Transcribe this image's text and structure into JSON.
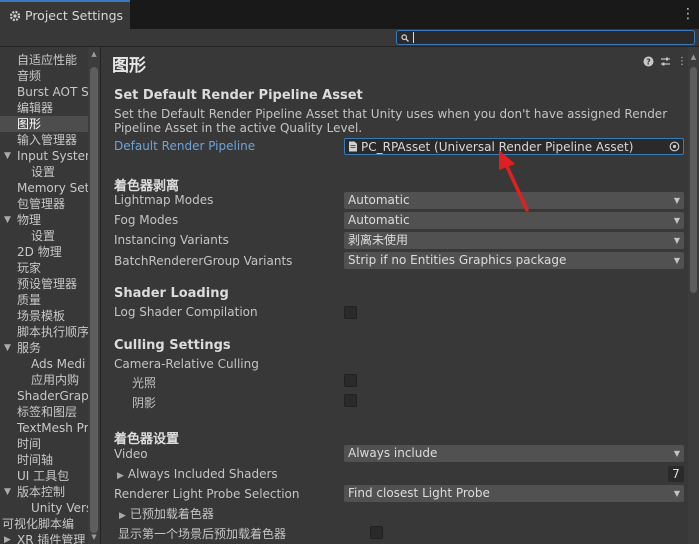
{
  "window": {
    "tab_title": "Project Settings",
    "tab_icon": "gear-icon",
    "menu_icon": "kebab-menu-icon"
  },
  "search": {
    "value": "",
    "icon": "search-icon"
  },
  "sidebar": {
    "items": [
      {
        "label": "自适应性能",
        "indent": 1,
        "expander": "",
        "selected": false
      },
      {
        "label": "音频",
        "indent": 1,
        "expander": "",
        "selected": false
      },
      {
        "label": "Burst AOT S",
        "indent": 1,
        "expander": "",
        "selected": false
      },
      {
        "label": "编辑器",
        "indent": 1,
        "expander": "",
        "selected": false
      },
      {
        "label": "图形",
        "indent": 1,
        "expander": "",
        "selected": true
      },
      {
        "label": "输入管理器",
        "indent": 1,
        "expander": "",
        "selected": false
      },
      {
        "label": "Input Systen",
        "indent": 1,
        "expander": "▼",
        "selected": false
      },
      {
        "label": "设置",
        "indent": 2,
        "expander": "",
        "selected": false
      },
      {
        "label": "Memory Set",
        "indent": 1,
        "expander": "",
        "selected": false
      },
      {
        "label": "包管理器",
        "indent": 1,
        "expander": "",
        "selected": false
      },
      {
        "label": "物理",
        "indent": 1,
        "expander": "▼",
        "selected": false
      },
      {
        "label": "设置",
        "indent": 2,
        "expander": "",
        "selected": false
      },
      {
        "label": "2D 物理",
        "indent": 1,
        "expander": "",
        "selected": false
      },
      {
        "label": "玩家",
        "indent": 1,
        "expander": "",
        "selected": false
      },
      {
        "label": "预设管理器",
        "indent": 1,
        "expander": "",
        "selected": false
      },
      {
        "label": "质量",
        "indent": 1,
        "expander": "",
        "selected": false
      },
      {
        "label": "场景模板",
        "indent": 1,
        "expander": "",
        "selected": false
      },
      {
        "label": "脚本执行顺序",
        "indent": 1,
        "expander": "",
        "selected": false
      },
      {
        "label": "服务",
        "indent": 1,
        "expander": "▼",
        "selected": false
      },
      {
        "label": "Ads Medi",
        "indent": 2,
        "expander": "",
        "selected": false
      },
      {
        "label": "应用内购",
        "indent": 2,
        "expander": "",
        "selected": false
      },
      {
        "label": "ShaderGrapl",
        "indent": 1,
        "expander": "",
        "selected": false
      },
      {
        "label": "标签和图层",
        "indent": 1,
        "expander": "",
        "selected": false
      },
      {
        "label": "TextMesh Pr",
        "indent": 1,
        "expander": "",
        "selected": false
      },
      {
        "label": "时间",
        "indent": 1,
        "expander": "",
        "selected": false
      },
      {
        "label": "时间轴",
        "indent": 1,
        "expander": "",
        "selected": false
      },
      {
        "label": "UI 工具包",
        "indent": 1,
        "expander": "",
        "selected": false
      },
      {
        "label": "版本控制",
        "indent": 1,
        "expander": "▼",
        "selected": false
      },
      {
        "label": "Unity Vers",
        "indent": 2,
        "expander": "",
        "selected": false
      },
      {
        "label": "可视化脚本编",
        "indent": 0,
        "expander": "",
        "selected": false
      },
      {
        "label": "XR 插件管理",
        "indent": 1,
        "expander": "▶",
        "selected": false
      }
    ]
  },
  "main": {
    "title": "图形",
    "header_icons": [
      "help-icon",
      "preset-icon",
      "kebab-menu-icon"
    ],
    "pipeline_section": {
      "heading": "Set Default Render Pipeline Asset",
      "description": "Set the Default Render Pipeline Asset that Unity uses when you don't have assigned Render Pipeline Asset in the active Quality Level.",
      "field_label": "Default Render Pipeline",
      "field_value": "PC_RPAsset (Universal Render Pipeline Asset)"
    },
    "stripping_section": {
      "heading": "着色器剥离",
      "rows": [
        {
          "label": "Lightmap Modes",
          "value": "Automatic"
        },
        {
          "label": "Fog Modes",
          "value": "Automatic"
        },
        {
          "label": "Instancing Variants",
          "value": "剥离未使用"
        },
        {
          "label": "BatchRendererGroup Variants",
          "value": "Strip if no Entities Graphics package"
        }
      ]
    },
    "loading_section": {
      "heading": "Shader Loading",
      "log_label": "Log Shader Compilation",
      "log_checked": false
    },
    "culling_section": {
      "heading": "Culling Settings",
      "sub_label": "Camera-Relative Culling",
      "lights_label": "光照",
      "lights_checked": false,
      "shadows_label": "阴影",
      "shadows_checked": false
    },
    "shader_settings_section": {
      "heading": "着色器设置",
      "video_label": "Video",
      "video_value": "Always include",
      "always_included_label": "Always Included Shaders",
      "always_included_count": "7",
      "probe_label": "Renderer Light Probe Selection",
      "probe_value": "Find closest Light Probe",
      "preloaded_label": "已预加载着色器",
      "preload_after_scene_label": "显示第一个场景后预加载着色器",
      "preload_after_scene_checked": false
    }
  },
  "colors": {
    "background": "#383838",
    "tab_accent": "#3a79bb",
    "link_label": "#6ba3d9",
    "annotation_arrow": "#e02020"
  }
}
